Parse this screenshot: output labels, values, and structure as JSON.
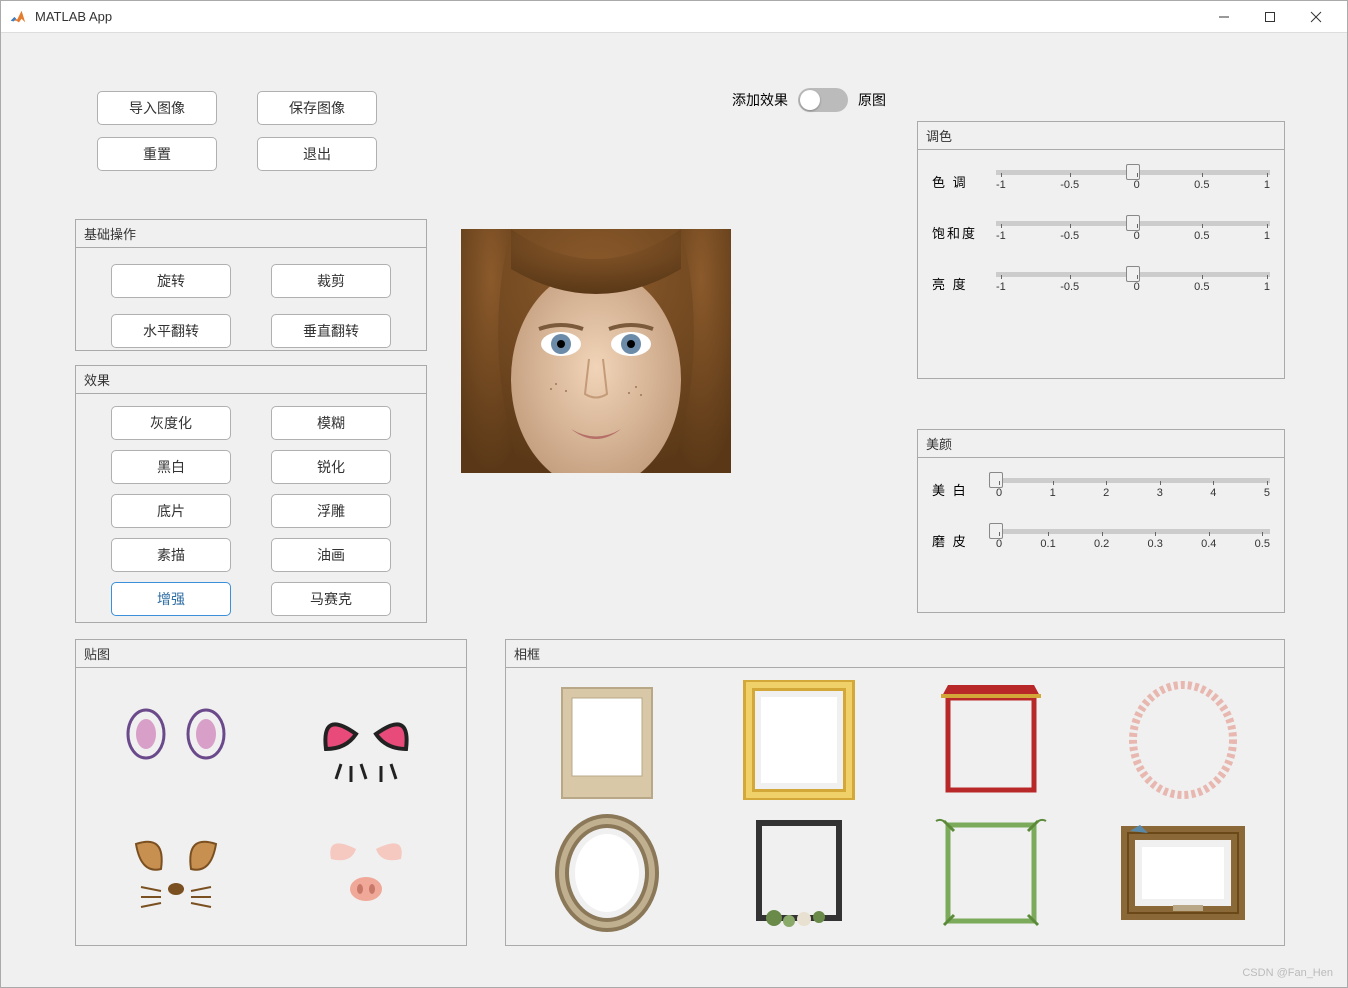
{
  "window": {
    "title": "MATLAB App"
  },
  "toolbar": {
    "import": "导入图像",
    "save": "保存图像",
    "reset": "重置",
    "exit": "退出"
  },
  "toggle": {
    "left": "添加效果",
    "right": "原图",
    "state": "off"
  },
  "panels": {
    "basic": {
      "title": "基础操作",
      "rotate": "旋转",
      "crop": "裁剪",
      "flipH": "水平翻转",
      "flipV": "垂直翻转"
    },
    "effects": {
      "title": "效果",
      "gray": "灰度化",
      "blur": "模糊",
      "bw": "黑白",
      "sharpen": "锐化",
      "neg": "底片",
      "emboss": "浮雕",
      "sketch": "素描",
      "oil": "油画",
      "enhance": "增强",
      "mosaic": "马赛克"
    },
    "color": {
      "title": "调色",
      "hue": {
        "label": "色  调",
        "value": 0,
        "min": -1,
        "max": 1,
        "ticks": [
          "-1",
          "-0.5",
          "0",
          "0.5",
          "1"
        ]
      },
      "sat": {
        "label": "饱和度",
        "value": 0,
        "min": -1,
        "max": 1,
        "ticks": [
          "-1",
          "-0.5",
          "0",
          "0.5",
          "1"
        ]
      },
      "bright": {
        "label": "亮  度",
        "value": 0,
        "min": -1,
        "max": 1,
        "ticks": [
          "-1",
          "-0.5",
          "0",
          "0.5",
          "1"
        ]
      }
    },
    "beauty": {
      "title": "美颜",
      "whiten": {
        "label": "美  白",
        "value": 0,
        "min": 0,
        "max": 5,
        "ticks": [
          "0",
          "1",
          "2",
          "3",
          "4",
          "5"
        ]
      },
      "smooth": {
        "label": "磨  皮",
        "value": 0,
        "min": 0,
        "max": 0.5,
        "ticks": [
          "0",
          "0.1",
          "0.2",
          "0.3",
          "0.4",
          "0.5"
        ]
      }
    },
    "sticker": {
      "title": "贴图"
    },
    "frame": {
      "title": "相框"
    }
  },
  "watermark": "CSDN @Fan_Hen"
}
